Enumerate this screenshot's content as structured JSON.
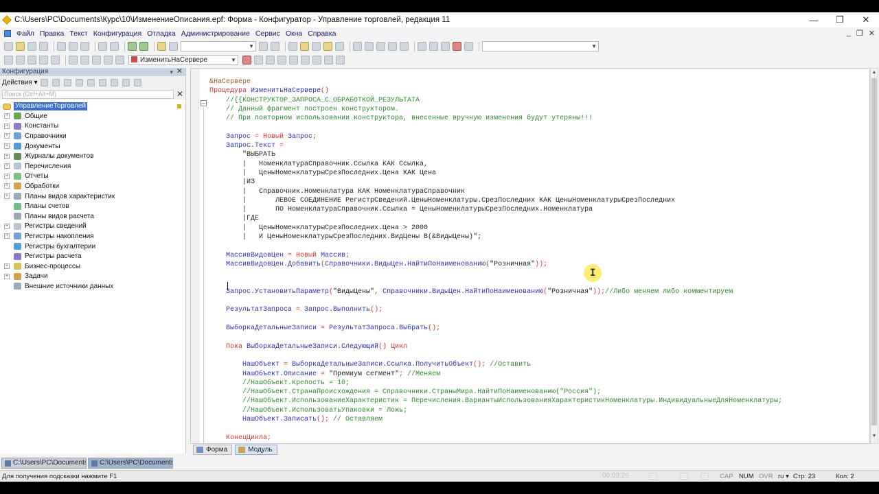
{
  "window": {
    "title": "C:\\Users\\PC\\Documents\\Курс\\10\\ИзменениеОписания.epf: Форма - Конфигуратор - Управление торговлей, редакция 11",
    "controls": [
      "—",
      "❐",
      "✕"
    ],
    "inner_controls": [
      "_",
      "❐",
      "✕"
    ]
  },
  "menu": [
    "Файл",
    "Правка",
    "Текст",
    "Конфигурация",
    "Отладка",
    "Администрирование",
    "Сервис",
    "Окна",
    "Справка"
  ],
  "toolbar": {
    "combo1_value": "",
    "proc_combo_value": "ИзменитьНаСервере",
    "combo3_value": ""
  },
  "left_panel": {
    "title": "Конфигурация",
    "pin": "▾",
    "actions_label": "Действия ▾",
    "search_placeholder": "Поиск (Ctrl+Alt+M)",
    "root": "УправлениеТорговлей",
    "items": [
      {
        "label": "Общие",
        "expandable": true,
        "icon": "common-icon"
      },
      {
        "label": "Константы",
        "expandable": true,
        "icon": "constants-icon"
      },
      {
        "label": "Справочники",
        "expandable": true,
        "icon": "catalogs-icon"
      },
      {
        "label": "Документы",
        "expandable": true,
        "icon": "documents-icon"
      },
      {
        "label": "Журналы документов",
        "expandable": true,
        "icon": "journals-icon"
      },
      {
        "label": "Перечисления",
        "expandable": true,
        "icon": "enums-icon"
      },
      {
        "label": "Отчеты",
        "expandable": true,
        "icon": "reports-icon"
      },
      {
        "label": "Обработки",
        "expandable": true,
        "icon": "dataprocessors-icon"
      },
      {
        "label": "Планы видов характеристик",
        "expandable": true,
        "icon": "chart-of-characteristics-icon"
      },
      {
        "label": "Планы счетов",
        "expandable": false,
        "icon": "chart-of-accounts-icon"
      },
      {
        "label": "Планы видов расчета",
        "expandable": false,
        "icon": "calculation-types-icon"
      },
      {
        "label": "Регистры сведений",
        "expandable": true,
        "icon": "info-registers-icon"
      },
      {
        "label": "Регистры накопления",
        "expandable": true,
        "icon": "accumulation-registers-icon"
      },
      {
        "label": "Регистры бухгалтерии",
        "expandable": false,
        "icon": "accounting-registers-icon"
      },
      {
        "label": "Регистры расчета",
        "expandable": false,
        "icon": "calculation-registers-icon"
      },
      {
        "label": "Бизнес-процессы",
        "expandable": true,
        "icon": "business-processes-icon"
      },
      {
        "label": "Задачи",
        "expandable": true,
        "icon": "tasks-icon"
      },
      {
        "label": "Внешние источники данных",
        "expandable": false,
        "icon": "external-sources-icon"
      }
    ]
  },
  "code_lines": [
    [
      {
        "t": "&НаСервере",
        "c": "pp"
      }
    ],
    [
      {
        "t": "Процедура ",
        "c": "kw"
      },
      {
        "t": "ИзменитьНаСервере",
        "c": "id"
      },
      {
        "t": "()",
        "c": "kw"
      }
    ],
    [
      {
        "t": "    //{{КОНСТРУКТОР_ЗАПРОСА_С_ОБРАБОТКОЙ_РЕЗУЛЬТАТА",
        "c": "cm"
      }
    ],
    [
      {
        "t": "    // Данный фрагмент построен конструктором.",
        "c": "cm"
      }
    ],
    [
      {
        "t": "    // При повторном использовании конструктора, внесенные вручную изменения будут утеряны!!!",
        "c": "cm"
      }
    ],
    [
      {
        "t": "",
        "c": "st"
      }
    ],
    [
      {
        "t": "    Запрос",
        "c": "id"
      },
      {
        "t": " = ",
        "c": "kw"
      },
      {
        "t": "Новый",
        "c": "kw"
      },
      {
        "t": " Запрос",
        "c": "id"
      },
      {
        "t": ";",
        "c": "kw"
      }
    ],
    [
      {
        "t": "    Запрос.Текст",
        "c": "id"
      },
      {
        "t": " = ",
        "c": "kw"
      }
    ],
    [
      {
        "t": "        \"ВЫБРАТЬ",
        "c": "st"
      }
    ],
    [
      {
        "t": "        |   НоменклатураСправочник.Ссылка КАК Ссылка,",
        "c": "st"
      }
    ],
    [
      {
        "t": "        |   ЦеныНоменклатурыСрезПоследних.Цена КАК Цена",
        "c": "st"
      }
    ],
    [
      {
        "t": "        |ИЗ",
        "c": "st"
      }
    ],
    [
      {
        "t": "        |   Справочник.Номенклатура КАК НоменклатураСправочник",
        "c": "st"
      }
    ],
    [
      {
        "t": "        |       ЛЕВОЕ СОЕДИНЕНИЕ РегистрСведений.ЦеныНоменклатуры.СрезПоследних КАК ЦеныНоменклатурыСрезПоследних",
        "c": "st"
      }
    ],
    [
      {
        "t": "        |       ПО НоменклатураСправочник.Ссылка = ЦеныНоменклатурыСрезПоследних.Номенклатура",
        "c": "st"
      }
    ],
    [
      {
        "t": "        |ГДЕ",
        "c": "st"
      }
    ],
    [
      {
        "t": "        |   ЦеныНоменклатурыСрезПоследних.Цена > 2000",
        "c": "st"
      }
    ],
    [
      {
        "t": "        |   И ЦеныНоменклатурыСрезПоследних.ВидЦены В(&ВидыЦены)\";",
        "c": "st"
      }
    ],
    [
      {
        "t": "",
        "c": "st"
      }
    ],
    [
      {
        "t": "    МассивВидовЦен",
        "c": "id"
      },
      {
        "t": " = ",
        "c": "kw"
      },
      {
        "t": "Новый",
        "c": "kw"
      },
      {
        "t": " Массив",
        "c": "id"
      },
      {
        "t": ";",
        "c": "kw"
      }
    ],
    [
      {
        "t": "    МассивВидовЦен.Добавить",
        "c": "id"
      },
      {
        "t": "(",
        "c": "kw"
      },
      {
        "t": "Справочники.ВидыЦен.НайтиПоНаименованию",
        "c": "id"
      },
      {
        "t": "(",
        "c": "kw"
      },
      {
        "t": "\"Розничная\"",
        "c": "st"
      },
      {
        "t": "));",
        "c": "kw"
      }
    ],
    [
      {
        "t": "",
        "c": "st"
      }
    ],
    [
      {
        "t": "",
        "c": "st"
      }
    ],
    [
      {
        "t": "    Запрос.УстановитьПараметр",
        "c": "id"
      },
      {
        "t": "(",
        "c": "kw"
      },
      {
        "t": "\"ВидыЦены\"",
        "c": "st"
      },
      {
        "t": ", ",
        "c": "kw"
      },
      {
        "t": "Справочники.ВидыЦен.НайтиПоНаименованию",
        "c": "id"
      },
      {
        "t": "(",
        "c": "kw"
      },
      {
        "t": "\"Розничная\"",
        "c": "st"
      },
      {
        "t": "));",
        "c": "kw"
      },
      {
        "t": "//Либо меняем либо комментируем",
        "c": "cm"
      }
    ],
    [
      {
        "t": "",
        "c": "st"
      }
    ],
    [
      {
        "t": "    РезультатЗапроса",
        "c": "id"
      },
      {
        "t": " = ",
        "c": "kw"
      },
      {
        "t": "Запрос.Выполнить",
        "c": "id"
      },
      {
        "t": "();",
        "c": "kw"
      }
    ],
    [
      {
        "t": "",
        "c": "st"
      }
    ],
    [
      {
        "t": "    ВыборкаДетальныеЗаписи",
        "c": "id"
      },
      {
        "t": " = ",
        "c": "kw"
      },
      {
        "t": "РезультатЗапроса.Выбрать",
        "c": "id"
      },
      {
        "t": "();",
        "c": "kw"
      }
    ],
    [
      {
        "t": "",
        "c": "st"
      }
    ],
    [
      {
        "t": "    Пока ",
        "c": "kw"
      },
      {
        "t": "ВыборкаДетальныеЗаписи.Следующий",
        "c": "id"
      },
      {
        "t": "() ",
        "c": "kw"
      },
      {
        "t": "Цикл",
        "c": "kw"
      }
    ],
    [
      {
        "t": "",
        "c": "st"
      }
    ],
    [
      {
        "t": "        НашОбъект",
        "c": "id"
      },
      {
        "t": " = ",
        "c": "kw"
      },
      {
        "t": "ВыборкаДетальныеЗаписи.Ссылка.ПолучитьОбъект",
        "c": "id"
      },
      {
        "t": "(); ",
        "c": "kw"
      },
      {
        "t": "//Оставить",
        "c": "cm"
      }
    ],
    [
      {
        "t": "        НашОбъект.Описание",
        "c": "id"
      },
      {
        "t": " = ",
        "c": "kw"
      },
      {
        "t": "\"Премиум сегмент\"",
        "c": "st"
      },
      {
        "t": "; ",
        "c": "kw"
      },
      {
        "t": "//Меняем",
        "c": "cm"
      }
    ],
    [
      {
        "t": "        //НашОбъект.Крепость = 10;",
        "c": "cm"
      }
    ],
    [
      {
        "t": "        //НашОбъект.СтранаПроисхождения = Справочники.СтраныМира.НайтиПоНаименованию(\"Россия\");",
        "c": "cm"
      }
    ],
    [
      {
        "t": "        //НашОбъект.ИспользованиеХарактеристик = Перечисления.ВариантыИспользованияХарактеристикНоменклатуры.ИндивидуальныеДляНоменклатуры;",
        "c": "cm"
      }
    ],
    [
      {
        "t": "        //НашОбъект.ИспользоватьУпаковки = Ложь;",
        "c": "cm"
      }
    ],
    [
      {
        "t": "        НашОбъект.Записать",
        "c": "id"
      },
      {
        "t": "(); ",
        "c": "kw"
      },
      {
        "t": "// Оставляем",
        "c": "cm"
      }
    ],
    [
      {
        "t": "",
        "c": "st"
      }
    ],
    [
      {
        "t": "    КонецЦикла",
        "c": "kw"
      },
      {
        "t": ";",
        "c": "kw"
      }
    ]
  ],
  "editor_tabs": [
    {
      "label": "Форма",
      "active": false
    },
    {
      "label": "Модуль",
      "active": true
    }
  ],
  "window_tabs": [
    {
      "label": "C:\\Users\\PC\\Documents\\K...",
      "active": false
    },
    {
      "label": "C:\\Users\\PC\\Documents\\K...",
      "active": true
    }
  ],
  "status": {
    "hint": "Для получения подсказки нажмите F1",
    "timer": "00:03:26",
    "cap": "CAP",
    "num": "NUM",
    "ovr": "OVR",
    "lang": "ru ▾",
    "line": "Стр: 23",
    "col": "Кол: 2"
  }
}
